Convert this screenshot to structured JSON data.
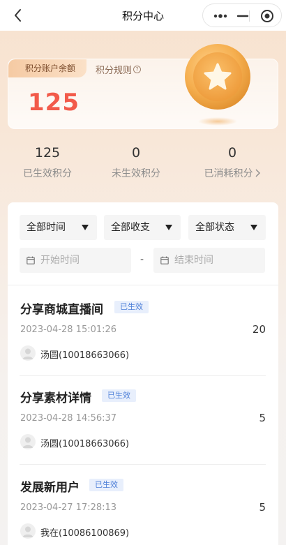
{
  "nav": {
    "title": "积分中心"
  },
  "balance": {
    "tag_label": "积分账户余额",
    "rules_label": "积分规则",
    "rules_hint": "?",
    "value": "125"
  },
  "stats": [
    {
      "value": "125",
      "label": "已生效积分"
    },
    {
      "value": "0",
      "label": "未生效积分"
    },
    {
      "value": "0",
      "label": "已消耗积分"
    }
  ],
  "filters": {
    "time": "全部时间",
    "flow": "全部收支",
    "status": "全部状态",
    "start_placeholder": "开始时间",
    "end_placeholder": "结束时间",
    "range_separator": "-"
  },
  "records": [
    {
      "title": "分享商城直播间",
      "status": "已生效",
      "time": "2023-04-28 15:01:26",
      "points": "20",
      "user": "汤圆(10018663066)"
    },
    {
      "title": "分享素材详情",
      "status": "已生效",
      "time": "2023-04-28 14:56:37",
      "points": "5",
      "user": "汤圆(10018663066)"
    },
    {
      "title": "发展新用户",
      "status": "已生效",
      "time": "2023-04-27 17:28:13",
      "points": "5",
      "user": "我在(10086100869)"
    }
  ],
  "colors": {
    "accent_red": "#f25a4a",
    "badge_blue": "#4d7fd8",
    "coin_gold": "#f2a94a"
  },
  "icons": [
    "back-chevron-icon",
    "more-dots-icon",
    "minimize-icon",
    "target-icon",
    "question-icon",
    "star-coin-icon",
    "chevron-right-icon",
    "dropdown-triangle-icon",
    "calendar-icon",
    "user-avatar-icon"
  ]
}
